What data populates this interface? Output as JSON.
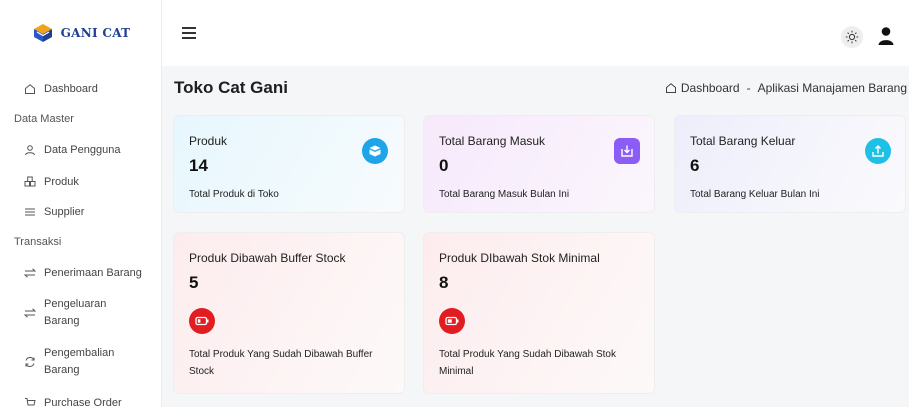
{
  "brand": {
    "name": "GANI CAT"
  },
  "sidebar": {
    "dashboard": "Dashboard",
    "section_master": "Data Master",
    "data_pengguna": "Data Pengguna",
    "produk": "Produk",
    "supplier": "Supplier",
    "section_transaksi": "Transaksi",
    "penerimaan_barang": "Penerimaan Barang",
    "pengeluaran_l1": "Pengeluaran",
    "pengeluaran_l2": "Barang",
    "pengembalian_l1": "Pengembalian",
    "pengembalian_l2": "Barang",
    "purchase_order": "Purchase Order"
  },
  "header": {
    "page_title": "Toko Cat Gani",
    "breadcrumb_home": "Dashboard",
    "breadcrumb_sep": "-",
    "breadcrumb_current": "Aplikasi Manajamen Barang"
  },
  "cards": [
    {
      "title": "Produk",
      "value": "14",
      "desc": "Total Produk di Toko",
      "icon": "box-icon",
      "color": "#1ea5e9"
    },
    {
      "title": "Total Barang Masuk",
      "value": "0",
      "desc": "Total Barang Masuk Bulan Ini",
      "icon": "download-icon",
      "color": "#8b5cf6"
    },
    {
      "title": "Total Barang Keluar",
      "value": "6",
      "desc": "Total Barang Keluar Bulan Ini",
      "icon": "upload-icon",
      "color": "#1ec0e6"
    },
    {
      "title": "Produk Dibawah Buffer Stock",
      "value": "5",
      "desc_l1": "Total Produk Yang Sudah Dibawah Buffer",
      "desc_l2": "Stock",
      "icon": "battery-low-icon",
      "color": "#e11d22"
    },
    {
      "title": "Produk DIbawah Stok Minimal",
      "value": "8",
      "desc_l1": "Total Produk Yang Sudah Dibawah Stok",
      "desc_l2": "Minimal",
      "icon": "battery-low-icon",
      "color": "#e11d22"
    }
  ]
}
